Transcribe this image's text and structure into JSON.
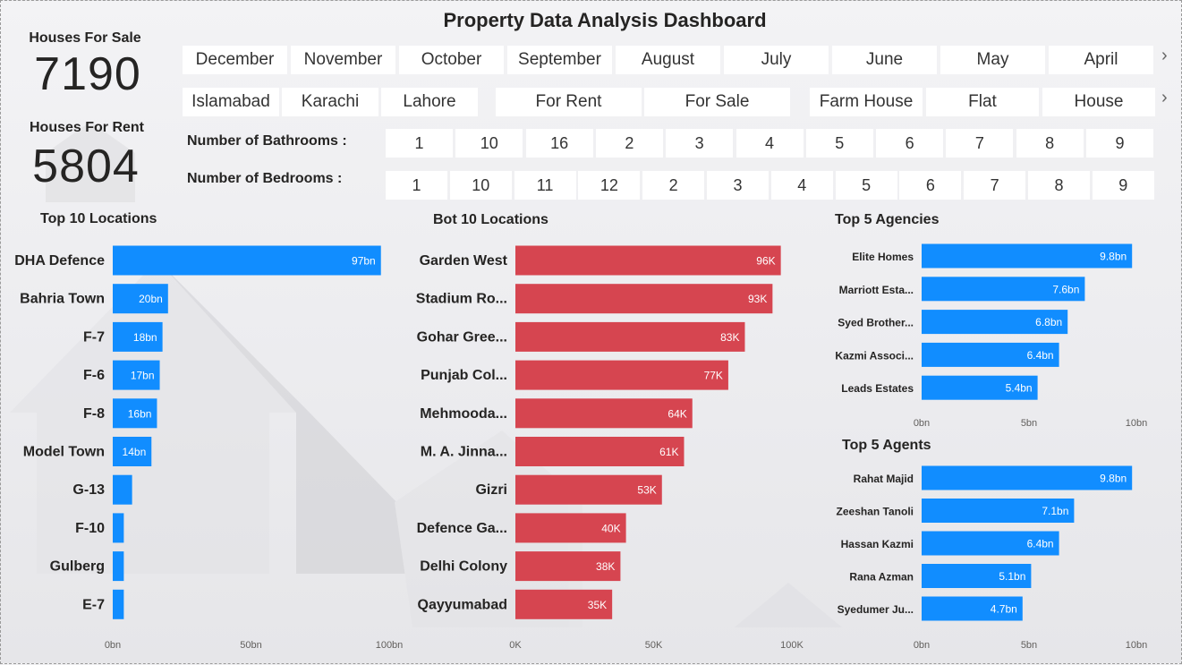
{
  "dashboard": {
    "title": "Property Data Analysis Dashboard"
  },
  "kpis": {
    "sale_label": "Houses For Sale",
    "sale_value": "7190",
    "rent_label": "Houses For Rent",
    "rent_value": "5804"
  },
  "filters": {
    "months": [
      "December",
      "November",
      "October",
      "September",
      "August",
      "July",
      "June",
      "May",
      "April"
    ],
    "cities": [
      "Islamabad",
      "Karachi",
      "Lahore"
    ],
    "purposes": [
      "For Rent",
      "For Sale"
    ],
    "property_types": [
      "Farm House",
      "Flat",
      "House"
    ],
    "bathrooms_label": "Number of Bathrooms :",
    "bathrooms": [
      "1",
      "10",
      "16",
      "2",
      "3",
      "4",
      "5",
      "6",
      "7",
      "8",
      "9"
    ],
    "bedrooms_label": "Number of Bedrooms :",
    "bedrooms": [
      "1",
      "10",
      "11",
      "12",
      "2",
      "3",
      "4",
      "5",
      "6",
      "7",
      "8",
      "9"
    ],
    "more_icon": "chevron-right-icon"
  },
  "colors": {
    "blue": "#118DFF",
    "red": "#D64550",
    "tile": "#FFFFFF",
    "text": "#252423"
  },
  "chart_data": [
    {
      "id": "top10",
      "type": "bar",
      "orientation": "horizontal",
      "title": "Top 10 Locations",
      "categories": [
        "DHA Defence",
        "Bahria Town",
        "F-7",
        "F-6",
        "F-8",
        "Model Town",
        "G-13",
        "F-10",
        "Gulberg",
        "E-7"
      ],
      "values": [
        97,
        20,
        18,
        17,
        16,
        14,
        7,
        4,
        4,
        4
      ],
      "data_labels": [
        "97bn",
        "20bn",
        "18bn",
        "17bn",
        "16bn",
        "14bn",
        "",
        "",
        "",
        ""
      ],
      "xlim": [
        0,
        100
      ],
      "ticks": [
        0,
        50,
        100
      ],
      "tick_labels": [
        "0bn",
        "50bn",
        "100bn"
      ],
      "unit": "bn",
      "color": "#118DFF"
    },
    {
      "id": "bot10",
      "type": "bar",
      "orientation": "horizontal",
      "title": "Bot 10 Locations",
      "categories": [
        "Garden West",
        "Stadium Ro...",
        "Gohar Gree...",
        "Punjab Col...",
        "Mehmooda...",
        "M. A. Jinna...",
        "Gizri",
        "Defence Ga...",
        "Delhi Colony",
        "Qayyumabad"
      ],
      "values": [
        96,
        93,
        83,
        77,
        64,
        61,
        53,
        40,
        38,
        35
      ],
      "data_labels": [
        "96K",
        "93K",
        "83K",
        "77K",
        "64K",
        "61K",
        "53K",
        "40K",
        "38K",
        "35K"
      ],
      "xlim": [
        0,
        100
      ],
      "ticks": [
        0,
        50,
        100
      ],
      "tick_labels": [
        "0K",
        "50K",
        "100K"
      ],
      "unit": "K",
      "color": "#D64550"
    },
    {
      "id": "agencies",
      "type": "bar",
      "orientation": "horizontal",
      "title": "Top 5 Agencies",
      "categories": [
        "Elite Homes",
        "Marriott Esta...",
        "Syed Brother...",
        "Kazmi Associ...",
        "Leads Estates"
      ],
      "values": [
        9.8,
        7.6,
        6.8,
        6.4,
        5.4
      ],
      "data_labels": [
        "9.8bn",
        "7.6bn",
        "6.8bn",
        "6.4bn",
        "5.4bn"
      ],
      "xlim": [
        0,
        10
      ],
      "ticks": [
        0,
        5,
        10
      ],
      "tick_labels": [
        "0bn",
        "5bn",
        "10bn"
      ],
      "unit": "bn",
      "color": "#118DFF"
    },
    {
      "id": "agents",
      "type": "bar",
      "orientation": "horizontal",
      "title": "Top 5 Agents",
      "categories": [
        "Rahat Majid",
        "Zeeshan Tanoli",
        "Hassan Kazmi",
        "Rana Azman",
        "Syedumer Ju..."
      ],
      "values": [
        9.8,
        7.1,
        6.4,
        5.1,
        4.7
      ],
      "data_labels": [
        "9.8bn",
        "7.1bn",
        "6.4bn",
        "5.1bn",
        "4.7bn"
      ],
      "xlim": [
        0,
        10
      ],
      "ticks": [
        0,
        5,
        10
      ],
      "tick_labels": [
        "0bn",
        "5bn",
        "10bn"
      ],
      "unit": "bn",
      "color": "#118DFF"
    }
  ]
}
